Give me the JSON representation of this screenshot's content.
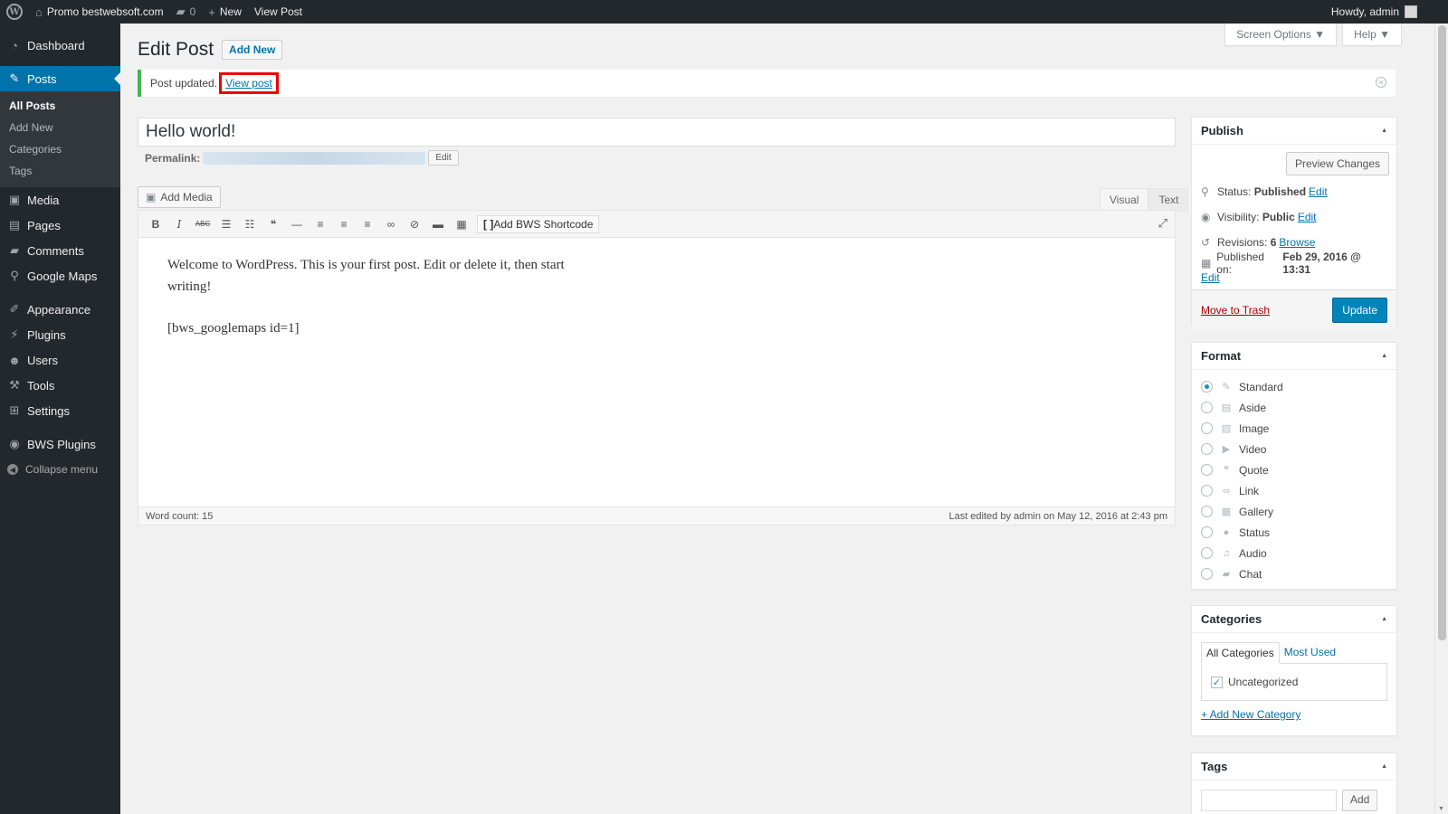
{
  "admin_bar": {
    "site_name": "Promo bestwebsoft.com",
    "comments_count": "0",
    "new_label": "New",
    "view_post_label": "View Post",
    "howdy": "Howdy, admin"
  },
  "sidebar": {
    "items": [
      {
        "label": "Dashboard",
        "icon": "dashboard-icon",
        "glyph": "◔"
      },
      {
        "label": "Posts",
        "icon": "pin-icon",
        "glyph": "✎"
      },
      {
        "label": "Media",
        "icon": "media-icon",
        "glyph": "▣"
      },
      {
        "label": "Pages",
        "icon": "pages-icon",
        "glyph": "▤"
      },
      {
        "label": "Comments",
        "icon": "comments-icon",
        "glyph": "▰"
      },
      {
        "label": "Google Maps",
        "icon": "map-pin-icon",
        "glyph": "⚲"
      },
      {
        "label": "Appearance",
        "icon": "appearance-icon",
        "glyph": "✐"
      },
      {
        "label": "Plugins",
        "icon": "plugins-icon",
        "glyph": "⚡"
      },
      {
        "label": "Users",
        "icon": "users-icon",
        "glyph": "☻"
      },
      {
        "label": "Tools",
        "icon": "tools-icon",
        "glyph": "⚒"
      },
      {
        "label": "Settings",
        "icon": "settings-icon",
        "glyph": "⊞"
      },
      {
        "label": "BWS Plugins",
        "icon": "bws-icon",
        "glyph": "◉"
      }
    ],
    "posts_submenu": [
      "All Posts",
      "Add New",
      "Categories",
      "Tags"
    ],
    "collapse_label": "Collapse menu"
  },
  "header": {
    "screen_options": "Screen Options ▼",
    "help": "Help ▼",
    "title": "Edit Post",
    "add_new": "Add New"
  },
  "notice": {
    "text": "Post updated.",
    "link": "View post"
  },
  "post": {
    "title": "Hello world!",
    "permalink_label": "Permalink:",
    "permalink_edit": "Edit",
    "content_line1": "Welcome to WordPress. This is your first post. Edit or delete it, then start writing!",
    "content_line2": "[bws_googlemaps id=1]"
  },
  "editor": {
    "add_media": "Add Media",
    "tab_visual": "Visual",
    "tab_text": "Text",
    "bws_shortcode": "Add BWS Shortcode",
    "word_count": "Word count: 15",
    "last_edited": "Last edited by admin on May 12, 2016 at 2:43 pm"
  },
  "publish": {
    "title": "Publish",
    "preview": "Preview Changes",
    "status_label": "Status:",
    "status_value": "Published",
    "visibility_label": "Visibility:",
    "visibility_value": "Public",
    "revisions_label": "Revisions:",
    "revisions_value": "6",
    "browse": "Browse",
    "published_on_label": "Published on:",
    "published_on_value": "Feb 29, 2016 @ 13:31",
    "edit": "Edit",
    "trash": "Move to Trash",
    "update": "Update"
  },
  "format": {
    "title": "Format",
    "options": [
      {
        "label": "Standard",
        "icon": "pin-icon",
        "glyph": "✎",
        "checked": true
      },
      {
        "label": "Aside",
        "icon": "aside-icon",
        "glyph": "▤",
        "checked": false
      },
      {
        "label": "Image",
        "icon": "image-icon",
        "glyph": "▨",
        "checked": false
      },
      {
        "label": "Video",
        "icon": "video-icon",
        "glyph": "▶",
        "checked": false
      },
      {
        "label": "Quote",
        "icon": "quote-icon",
        "glyph": "❝",
        "checked": false
      },
      {
        "label": "Link",
        "icon": "link-icon",
        "glyph": "∞",
        "checked": false
      },
      {
        "label": "Gallery",
        "icon": "gallery-icon",
        "glyph": "▦",
        "checked": false
      },
      {
        "label": "Status",
        "icon": "status-icon",
        "glyph": "●",
        "checked": false
      },
      {
        "label": "Audio",
        "icon": "audio-icon",
        "glyph": "♫",
        "checked": false
      },
      {
        "label": "Chat",
        "icon": "chat-icon",
        "glyph": "▰",
        "checked": false
      }
    ]
  },
  "categories": {
    "title": "Categories",
    "tab_all": "All Categories",
    "tab_most_used": "Most Used",
    "item": "Uncategorized",
    "add_new": "+ Add New Category"
  },
  "tags": {
    "title": "Tags",
    "add": "Add"
  },
  "colors": {
    "admin_bg": "#23282d",
    "accent": "#0073aa",
    "primary_button": "#0085ba",
    "notice_success": "#46b450",
    "highlight": "#ee0000"
  }
}
